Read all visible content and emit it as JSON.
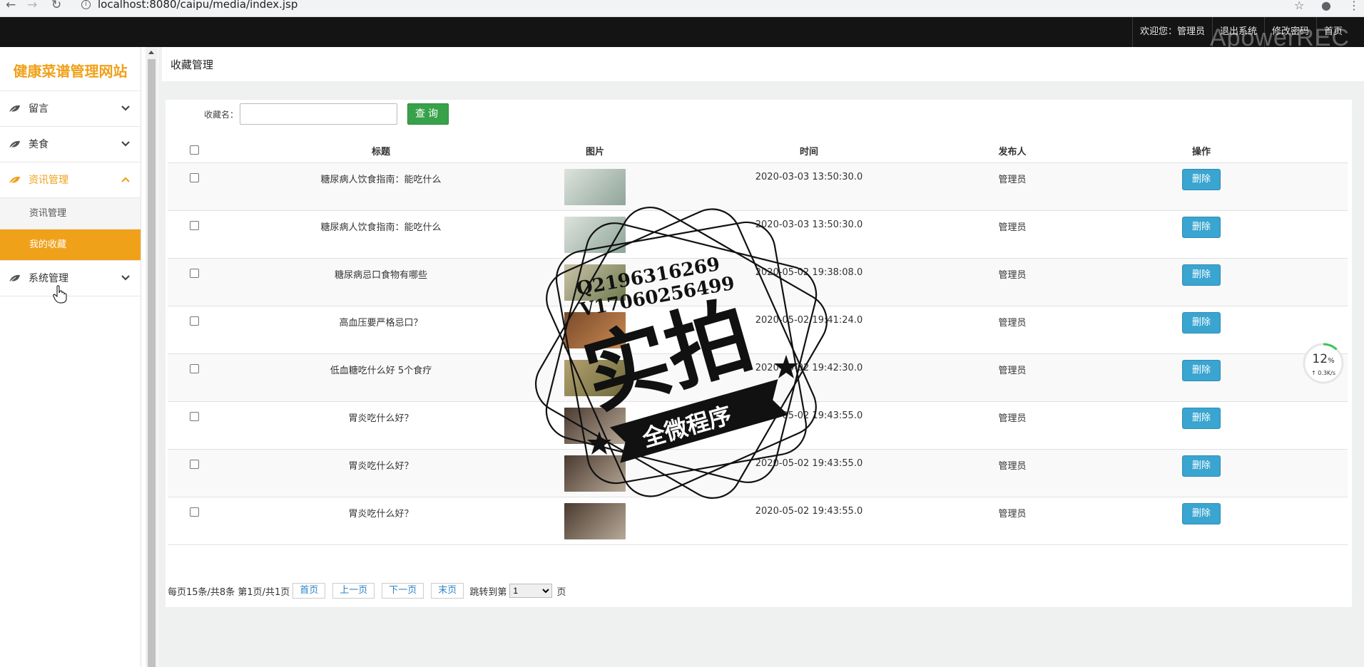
{
  "browser": {
    "url": "localhost:8080/caipu/media/index.jsp"
  },
  "topbar": {
    "welcome": "欢迎您：管理员",
    "logout": "退出系统",
    "change_password": "修改密码",
    "home": "首页",
    "recorder_watermark": "ApowerREC"
  },
  "sidebar": {
    "site_title": "健康菜谱管理网站",
    "items": [
      {
        "label": "留言",
        "expanded": false
      },
      {
        "label": "美食",
        "expanded": false
      },
      {
        "label": "资讯管理",
        "expanded": true
      },
      {
        "label": "系统管理",
        "expanded": false
      }
    ],
    "sub_items": [
      {
        "label": "资讯管理"
      },
      {
        "label": "我的收藏"
      }
    ],
    "accent_color": "#f0a11a"
  },
  "page": {
    "title": "收藏管理"
  },
  "search": {
    "label": "收藏名：",
    "value": "",
    "button": "查询"
  },
  "table": {
    "headers": [
      "标题",
      "图片",
      "时间",
      "发布人",
      "操作"
    ],
    "delete_label": "删除",
    "rows": [
      {
        "title": "糖尿病人饮食指南：能吃什么",
        "time": "2020-03-03 13:50:30.0",
        "publisher": "管理员"
      },
      {
        "title": "糖尿病人饮食指南：能吃什么",
        "time": "2020-03-03 13:50:30.0",
        "publisher": "管理员"
      },
      {
        "title": "糖尿病忌口食物有哪些",
        "time": "2020-05-02 19:38:08.0",
        "publisher": "管理员"
      },
      {
        "title": "高血压要严格忌口？",
        "time": "2020-05-02 19:41:24.0",
        "publisher": "管理员"
      },
      {
        "title": "低血糖吃什么好 5个食疗",
        "time": "2020-05-02 19:42:30.0",
        "publisher": "管理员"
      },
      {
        "title": "胃炎吃什么好？",
        "time": "2020-05-02 19:43:55.0",
        "publisher": "管理员"
      },
      {
        "title": "胃炎吃什么好？",
        "time": "2020-05-02 19:43:55.0",
        "publisher": "管理员"
      },
      {
        "title": "胃炎吃什么好？",
        "time": "2020-05-02 19:43:55.0",
        "publisher": "管理员"
      }
    ]
  },
  "pager": {
    "summary": "每页15条/共8条 第1页/共1页",
    "first": "首页",
    "prev": "上一页",
    "next": "下一页",
    "last": "末页",
    "jump_label": "跳转到第",
    "jump_value": "1",
    "page_unit": "页"
  },
  "stamp": {
    "qq": "Q2196316269",
    "wechat": "V17060256499",
    "main": "实拍",
    "banner": "全微程序"
  },
  "gauge": {
    "percent": "12",
    "percent_unit": "%",
    "rate": "↑ 0.3K/s",
    "level": 0.12
  }
}
